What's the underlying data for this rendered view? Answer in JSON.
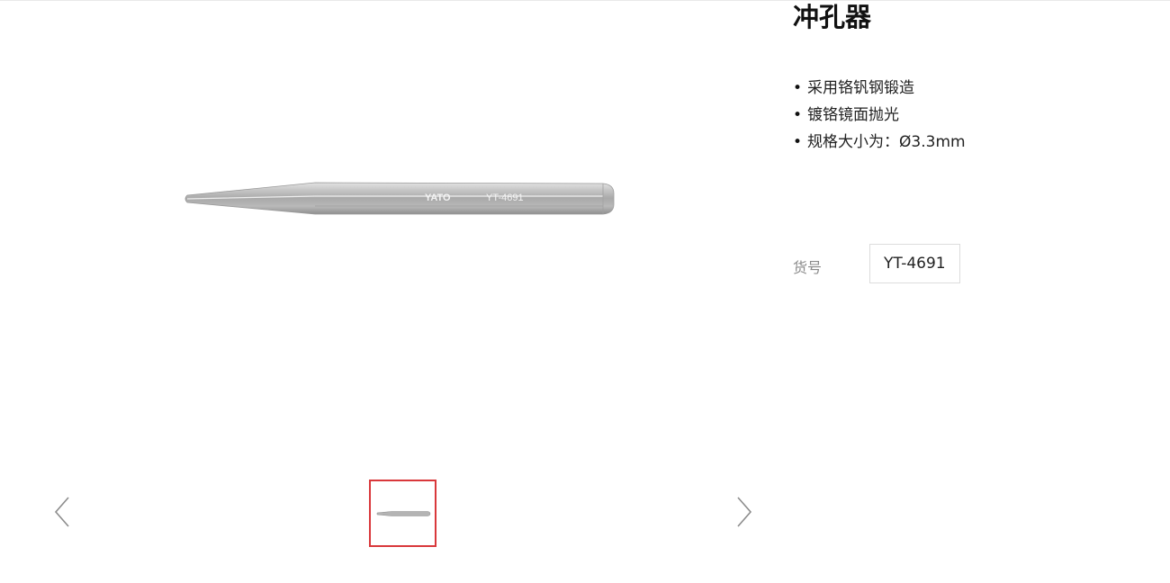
{
  "product": {
    "title": "冲孔器",
    "features": [
      "采用铬钒钢锻造",
      "镀铬镜面抛光",
      "规格大小为：Ø3.3mm"
    ],
    "sku_label": "货号",
    "sku_value": "YT-4691"
  },
  "gallery": {
    "image_engraving_brand": "YATO",
    "image_engraving_code": "YT-4691",
    "prev_icon": "chevron-left-icon",
    "next_icon": "chevron-right-icon",
    "thumbnail_count": 1,
    "selected_thumbnail": 1
  },
  "colors": {
    "selected_border": "#d9383b",
    "muted_text": "#8a8a8a",
    "arrow": "#8c8c8c"
  }
}
